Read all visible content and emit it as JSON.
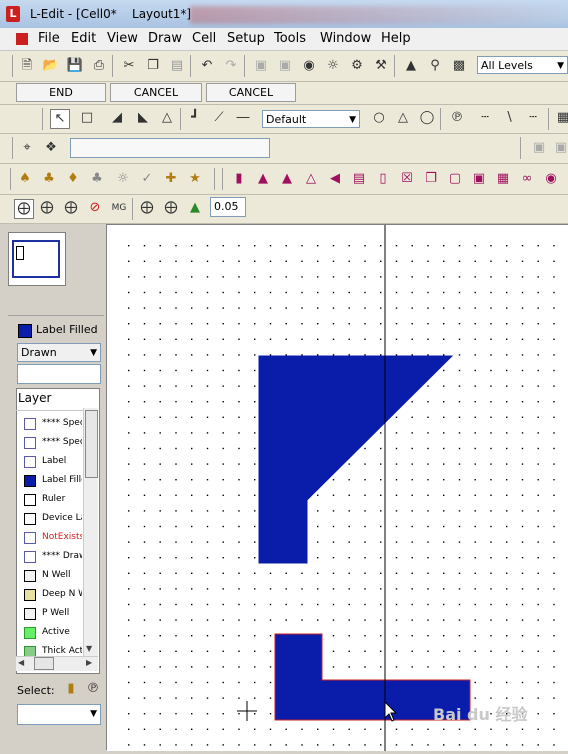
{
  "window": {
    "title": "L-Edit - [Cell0*    Layout1*]",
    "app_icon": "L"
  },
  "menu": [
    "File",
    "Edit",
    "View",
    "Draw",
    "Cell",
    "Setup",
    "Tools",
    "Window",
    "Help"
  ],
  "toolbar1": {
    "icons": [
      "new-file-icon",
      "open-folder-icon",
      "save-icon",
      "print-icon",
      "cut-icon",
      "copy-icon",
      "paste-icon",
      "undo-icon",
      "redo-icon",
      "box-icon",
      "box2-icon",
      "binoculars-icon",
      "find-icon",
      "find-replace-icon",
      "tools-icon",
      "hierarchy-icon",
      "zoom-icon",
      "layers-icon"
    ],
    "levels_value": "All Levels"
  },
  "command_buttons": [
    "END",
    "CANCEL",
    "CANCEL"
  ],
  "drawing_toolbar": {
    "style_value": "Default"
  },
  "snap_field_value": "0.05",
  "left_panel": {
    "current_layer": "Label Filled",
    "draw_mode": "Drawn",
    "layer_header": "Layer",
    "layers": [
      {
        "name": "**** Special",
        "color": "#ffffff",
        "border": "#5a5aa8",
        "text_color": "#000000"
      },
      {
        "name": "**** Special",
        "color": "#ffffff",
        "border": "#5a5aa8",
        "text_color": "#000000"
      },
      {
        "name": "Label",
        "color": "#ffffff",
        "border": "#5a5aa8",
        "text_color": "#000000"
      },
      {
        "name": "Label Filled",
        "color": "#0a1caa",
        "border": "#000000",
        "text_color": "#000000"
      },
      {
        "name": "Ruler",
        "color": "#ffffff",
        "border": "#000000",
        "text_color": "#000000"
      },
      {
        "name": "Device Labels",
        "color": "#ffffff",
        "border": "#000000",
        "text_color": "#000000"
      },
      {
        "name": "NotExists",
        "color": "#ffffff",
        "border": "#5a5aa8",
        "text_color": "#d42020"
      },
      {
        "name": "**** Drawn",
        "color": "#ffffff",
        "border": "#5a5aa8",
        "text_color": "#000000"
      },
      {
        "name": "N Well",
        "color": "#f2f2f2",
        "border": "#000000",
        "text_color": "#000000"
      },
      {
        "name": "Deep N Well",
        "color": "#e8e0a0",
        "border": "#000000",
        "text_color": "#000000"
      },
      {
        "name": "P Well",
        "color": "#f2f2f2",
        "border": "#000000",
        "text_color": "#000000"
      },
      {
        "name": "Active",
        "color": "#66ee66",
        "border": "#2c9a2c",
        "text_color": "#000000"
      },
      {
        "name": "Thick Active",
        "color": "#88cc88",
        "border": "#2c9a2c",
        "text_color": "#000000"
      }
    ],
    "select_label": "Select:"
  },
  "colors": {
    "shape_fill": "#0a1caa",
    "shape_border": "#cc2020",
    "grid_dot": "#000000"
  },
  "watermark": "Bai du 经验"
}
